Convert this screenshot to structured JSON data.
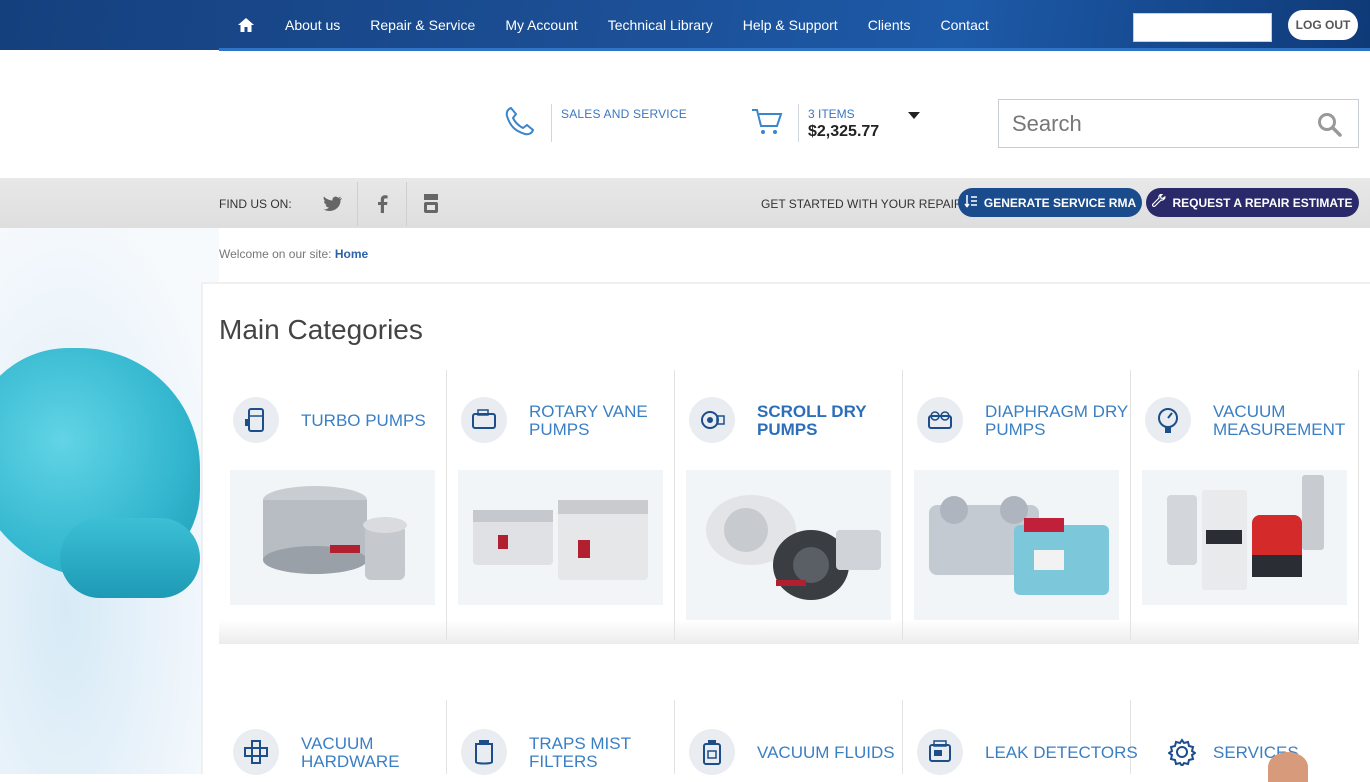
{
  "topnav": {
    "items": [
      "About us",
      "Repair & Service",
      "My Account",
      "Technical Library",
      "Help & Support",
      "Clients",
      "Contact"
    ],
    "logout_label": "LOG OUT"
  },
  "header": {
    "sales_label": "SALES AND SERVICE",
    "cart_items": "3 ITEMS",
    "cart_total": "$2,325.77",
    "search_placeholder": "Search"
  },
  "strip": {
    "find_us": "FIND US ON:",
    "get_started": "GET STARTED WITH YOUR REPAIR:",
    "rma_button": "GENERATE SERVICE RMA",
    "estimate_button": "REQUEST A REPAIR ESTIMATE"
  },
  "breadcrumb": {
    "prefix": "Welcome on our site:",
    "current": "Home"
  },
  "main": {
    "title": "Main Categories",
    "categories": [
      {
        "line1": "TURBO PUMPS",
        "line2": ""
      },
      {
        "line1": "ROTARY VANE",
        "line2": "PUMPS"
      },
      {
        "line1": "SCROLL DRY",
        "line2": "PUMPS"
      },
      {
        "line1": "DIAPHRAGM DRY",
        "line2": "PUMPS"
      },
      {
        "line1": "VACUUM",
        "line2": "MEASUREMENT"
      },
      {
        "line1": "VACUUM",
        "line2": "HARDWARE"
      },
      {
        "line1": "TRAPS MIST",
        "line2": "FILTERS"
      },
      {
        "line1": "VACUUM FLUIDS",
        "line2": ""
      },
      {
        "line1": "LEAK DETECTORS",
        "line2": ""
      },
      {
        "line1": "SERVICES",
        "line2": ""
      }
    ]
  },
  "colors": {
    "nav_blue": "#1c4f96",
    "accent_blue": "#3a7fc4",
    "rma_button": "#1a4b8c",
    "estimate_button": "#2a2a6a"
  }
}
